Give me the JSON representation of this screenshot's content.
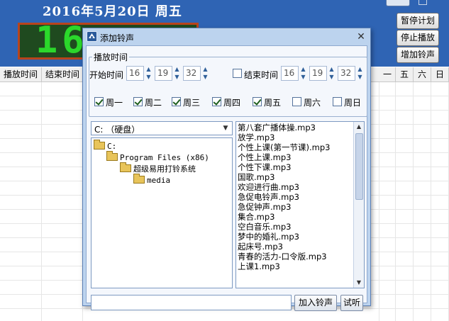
{
  "app": {
    "date_title": "2016年5月20日  周五",
    "clock": "16:  . . . ",
    "side_buttons": [
      "暂停计划",
      "停止播放",
      "增加铃声"
    ],
    "table_headers": [
      "播放时间",
      "结束时间",
      "一",
      "五",
      "六",
      "日"
    ]
  },
  "dialog": {
    "title": "添加铃声",
    "close_glyph": "✕",
    "group_title": "播放时间",
    "start_label": "开始时间",
    "start_time": {
      "hour": "16",
      "minute": "19",
      "second": "32"
    },
    "end_label": "结束时间",
    "end_enabled": false,
    "end_time": {
      "hour": "16",
      "minute": "19",
      "second": "32"
    },
    "weekdays": [
      {
        "label": "周一",
        "checked": true
      },
      {
        "label": "周二",
        "checked": true
      },
      {
        "label": "周三",
        "checked": true
      },
      {
        "label": "周四",
        "checked": true
      },
      {
        "label": "周五",
        "checked": true
      },
      {
        "label": "周六",
        "checked": false
      },
      {
        "label": "周日",
        "checked": false
      }
    ],
    "drive": "C: （硬盘）",
    "folders": [
      "C:",
      "Program Files (x86)",
      "超级易用打铃系统",
      "media"
    ],
    "files": [
      "第八套广播体操.mp3",
      "放学.mp3",
      "个性上课(第一节课).mp3",
      "个性上课.mp3",
      "个性下课.mp3",
      "国歌.mp3",
      "欢迎进行曲.mp3",
      "急促电铃声.mp3",
      "急促钟声.mp3",
      "集合.mp3",
      "空白音乐.mp3",
      "梦中的婚礼.mp3",
      "起床号.mp3",
      "青春的活力-口令版.mp3",
      "上课1.mp3"
    ],
    "path_value": "",
    "add_button": "加入铃声",
    "preview_button": "试听"
  },
  "icons": {
    "dialog_icon": "app-logo-icon",
    "spin_up": "▲",
    "spin_down": "▼",
    "dropdown": "▼",
    "folder": "folder-icon"
  }
}
